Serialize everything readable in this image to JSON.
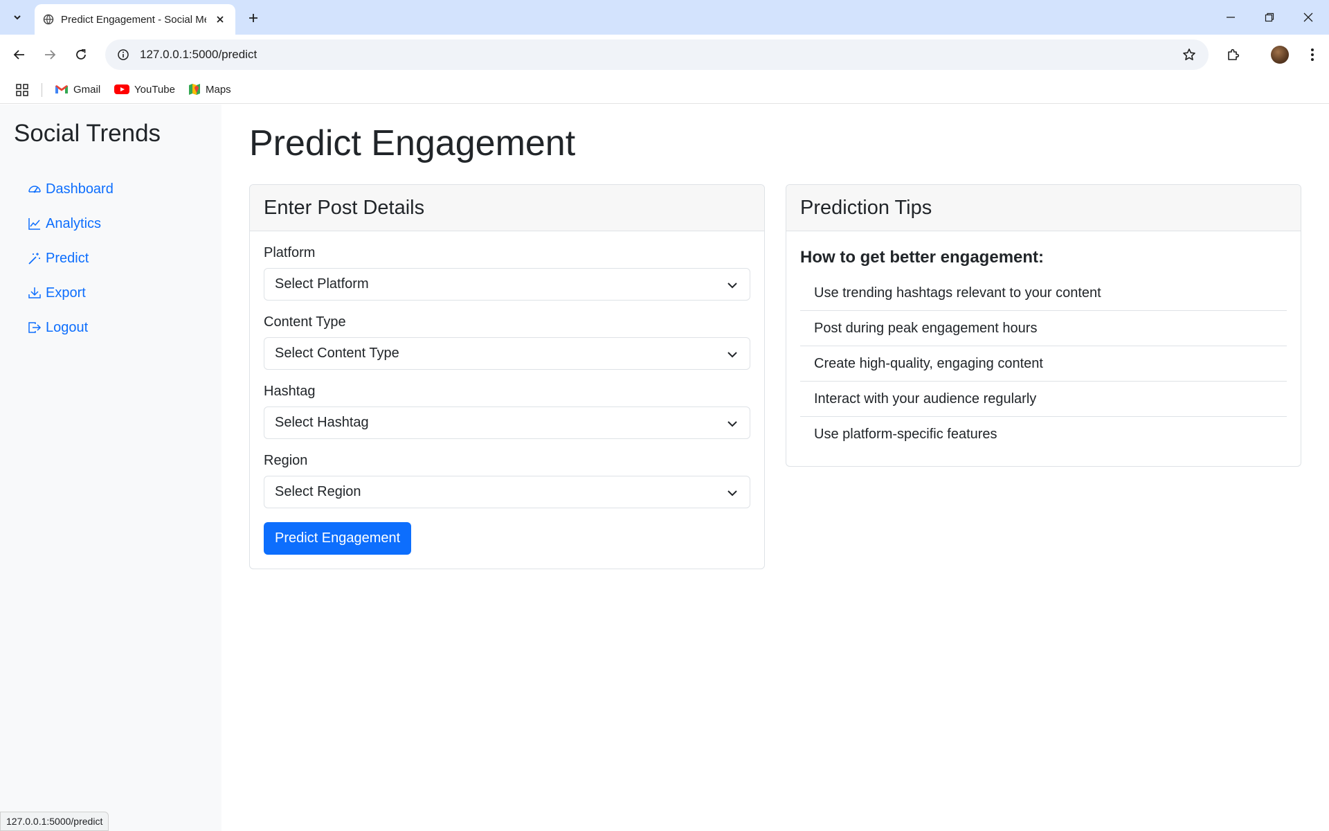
{
  "browser": {
    "tab_title": "Predict Engagement - Social Media",
    "url": "127.0.0.1:5000/predict",
    "bookmarks": [
      {
        "label": "Gmail",
        "icon": "gmail-icon"
      },
      {
        "label": "YouTube",
        "icon": "youtube-icon"
      },
      {
        "label": "Maps",
        "icon": "maps-icon"
      }
    ],
    "status_url": "127.0.0.1:5000/predict"
  },
  "sidebar": {
    "brand": "Social Trends",
    "items": [
      {
        "label": "Dashboard",
        "icon": "speedometer-icon"
      },
      {
        "label": "Analytics",
        "icon": "line-chart-icon"
      },
      {
        "label": "Predict",
        "icon": "magic-wand-icon"
      },
      {
        "label": "Export",
        "icon": "download-icon"
      },
      {
        "label": "Logout",
        "icon": "logout-icon"
      }
    ]
  },
  "main": {
    "title": "Predict Engagement",
    "form_card": {
      "header": "Enter Post Details",
      "fields": [
        {
          "label": "Platform",
          "value": "Select Platform"
        },
        {
          "label": "Content Type",
          "value": "Select Content Type"
        },
        {
          "label": "Hashtag",
          "value": "Select Hashtag"
        },
        {
          "label": "Region",
          "value": "Select Region"
        }
      ],
      "submit_label": "Predict Engagement"
    },
    "tips_card": {
      "header": "Prediction Tips",
      "subheading": "How to get better engagement:",
      "tips": [
        "Use trending hashtags relevant to your content",
        "Post during peak engagement hours",
        "Create high-quality, engaging content",
        "Interact with your audience regularly",
        "Use platform-specific features"
      ]
    }
  },
  "colors": {
    "primary": "#0d6efd",
    "sidebar_bg": "#f8f9fa",
    "tabbar_bg": "#d3e3fd"
  }
}
